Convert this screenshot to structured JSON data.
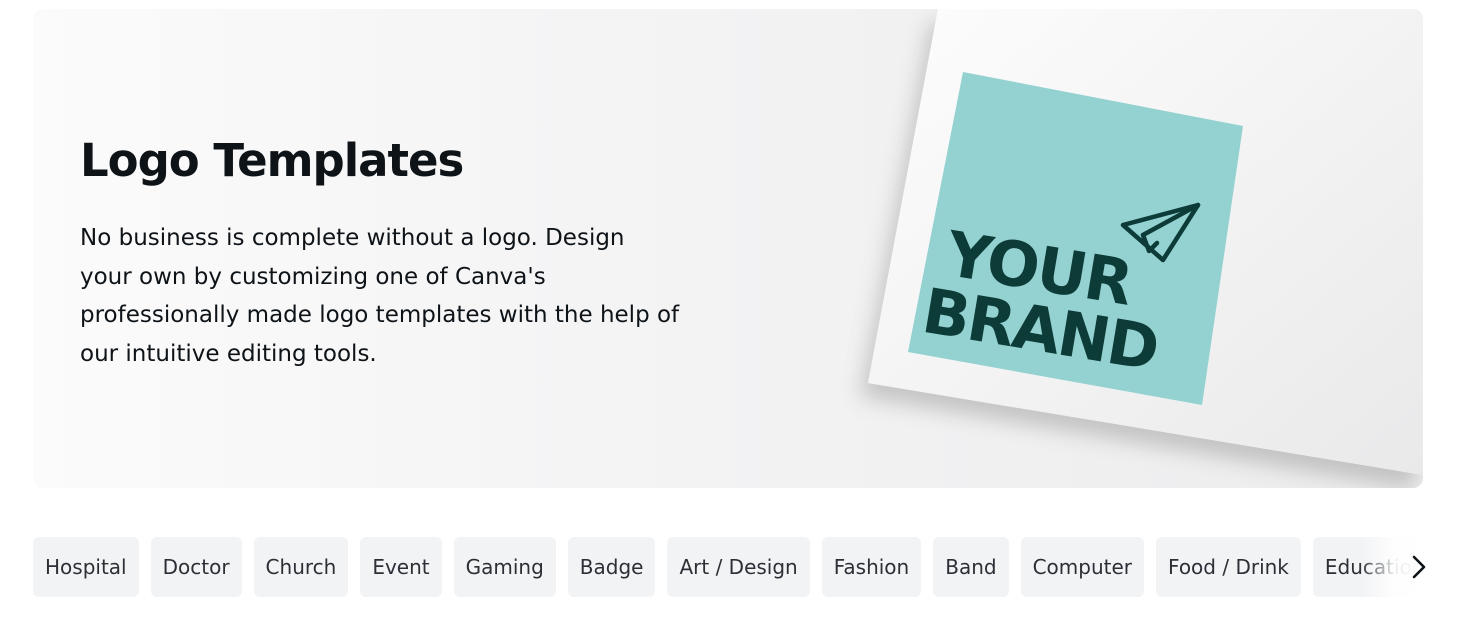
{
  "hero": {
    "title": "Logo Templates",
    "description": "No business is complete without a logo. Design your own by customizing one of Canva's professionally made logo templates with the help of our intuitive editing tools.",
    "image": {
      "line1": "YOUR",
      "line2": "BRAND",
      "icon": "paper-plane-icon",
      "card_color": "#94d1d1",
      "text_color": "#0d3b38"
    }
  },
  "categories": [
    "Hospital",
    "Doctor",
    "Church",
    "Event",
    "Gaming",
    "Badge",
    "Art / Design",
    "Fashion",
    "Band",
    "Computer",
    "Food / Drink",
    "Education"
  ],
  "scroll": {
    "icon": "chevron-right-icon"
  },
  "colors": {
    "chip_bg": "#f2f3f5",
    "chip_text": "#2c3036",
    "title": "#0e1318"
  }
}
